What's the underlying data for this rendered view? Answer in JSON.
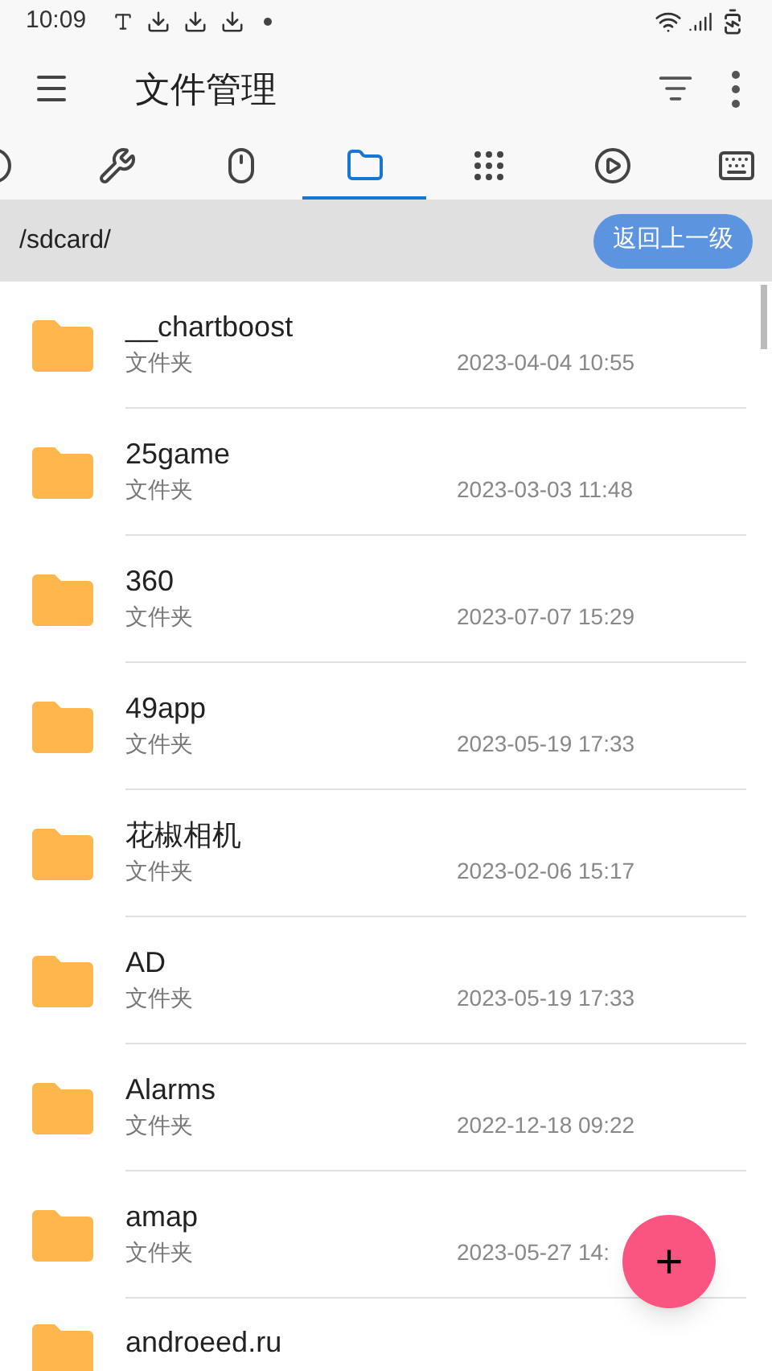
{
  "status_bar": {
    "time": "10:09"
  },
  "app_bar": {
    "title": "文件管理"
  },
  "tabs": [
    {
      "kind": "info",
      "selected": false
    },
    {
      "kind": "wrench",
      "selected": false
    },
    {
      "kind": "mouse",
      "selected": false
    },
    {
      "kind": "folder",
      "selected": true
    },
    {
      "kind": "apps",
      "selected": false
    },
    {
      "kind": "play",
      "selected": false
    },
    {
      "kind": "keyboard",
      "selected": false
    }
  ],
  "path_bar": {
    "path": "/sdcard/",
    "up_button": "返回上一级"
  },
  "files": [
    {
      "name": "__chartboost",
      "type": "文件夹",
      "date": "2023-04-04 10:55"
    },
    {
      "name": "25game",
      "type": "文件夹",
      "date": "2023-03-03 11:48"
    },
    {
      "name": "360",
      "type": "文件夹",
      "date": "2023-07-07 15:29"
    },
    {
      "name": "49app",
      "type": "文件夹",
      "date": "2023-05-19 17:33"
    },
    {
      "name": "花椒相机",
      "type": "文件夹",
      "date": "2023-02-06 15:17"
    },
    {
      "name": "AD",
      "type": "文件夹",
      "date": "2023-05-19 17:33"
    },
    {
      "name": "Alarms",
      "type": "文件夹",
      "date": "2022-12-18 09:22"
    },
    {
      "name": "amap",
      "type": "文件夹",
      "date": "2023-05-27 14:"
    },
    {
      "name": "androeed.ru"
    }
  ],
  "fab": {
    "label": "+"
  }
}
